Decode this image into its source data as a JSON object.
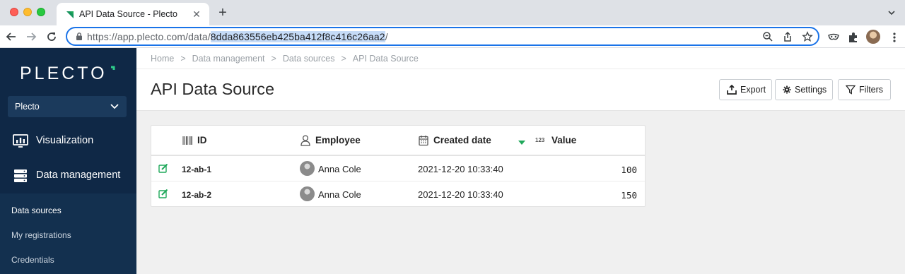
{
  "browser": {
    "tab_title": "API Data Source - Plecto",
    "url_prefix": "https://app.plecto.com/data/",
    "url_id": "8dda863556eb425ba412f8c416c26aa2",
    "url_suffix": "/"
  },
  "sidebar": {
    "logo": "PLECTO",
    "company": "Plecto",
    "items": [
      {
        "label": "Visualization",
        "icon": "chart-icon"
      },
      {
        "label": "Data management",
        "icon": "database-icon"
      }
    ],
    "subitems": [
      {
        "label": "Data sources",
        "active": true
      },
      {
        "label": "My registrations",
        "active": false
      },
      {
        "label": "Credentials",
        "active": false
      }
    ]
  },
  "header": {
    "breadcrumb": [
      "Home",
      "Data management",
      "Data sources",
      "API Data Source"
    ],
    "breadcrumb_sep": ">",
    "title": "API Data Source",
    "buttons": {
      "export": "Export",
      "settings": "Settings",
      "filters": "Filters"
    }
  },
  "table": {
    "columns": [
      "ID",
      "Employee",
      "Created date",
      "Value"
    ],
    "value_icon_text": "123",
    "sort_column": "Created date",
    "rows": [
      {
        "id": "12-ab-1",
        "employee": "Anna Cole",
        "created": "2021-12-20 10:33:40",
        "value": "100"
      },
      {
        "id": "12-ab-2",
        "employee": "Anna Cole",
        "created": "2021-12-20 10:33:40",
        "value": "150"
      }
    ]
  },
  "colors": {
    "sidebar_bg": "#0f2846",
    "accent_green": "#1fa85a",
    "omnibox_focus": "#1a73e8"
  }
}
